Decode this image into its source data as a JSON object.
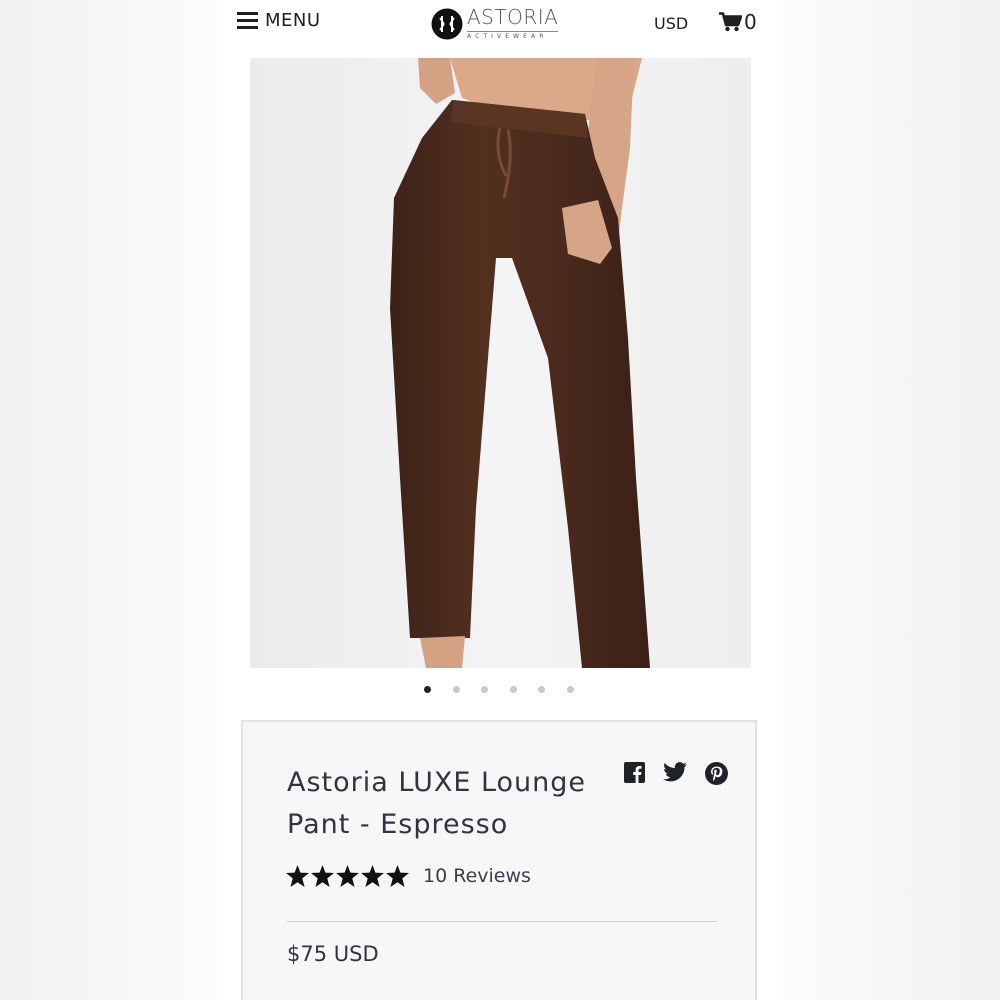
{
  "header": {
    "menu_label": "MENU",
    "brand_name": "ASTORIA",
    "brand_sub": "ACTIVEWEAR",
    "currency": "USD",
    "cart_count": "0"
  },
  "gallery": {
    "slide_count": 6,
    "active_index": 0
  },
  "product": {
    "title": "Astoria LUXE Lounge Pant - Espresso",
    "rating": 5,
    "reviews_label": "10 Reviews",
    "price": "$75 USD"
  },
  "social": [
    "facebook-icon",
    "twitter-icon",
    "pinterest-icon"
  ],
  "colors": {
    "pant": "#4a2a1e",
    "text": "#2f3440",
    "card_bg": "#f7f7f8",
    "dot_active": "#222222",
    "dot_inactive": "#c8c8c8"
  }
}
